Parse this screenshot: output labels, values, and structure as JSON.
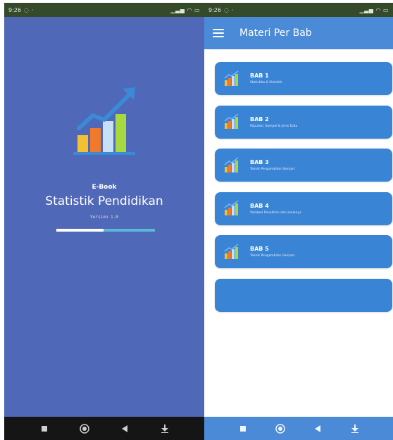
{
  "left_screen": {
    "status_bar": {
      "time": "9:26"
    },
    "splash": {
      "subtitle": "E-Book",
      "title": "Statistik Pendidikan",
      "version": "Version 1.0",
      "progress_fraction": 0.48,
      "icon": "bar-chart-growth-icon"
    },
    "nav": {
      "buttons": [
        "square-icon",
        "circle-icon",
        "back-triangle-icon",
        "download-icon"
      ]
    }
  },
  "right_screen": {
    "status_bar": {
      "time": "9:26"
    },
    "app_bar": {
      "title": "Materi Per Bab",
      "menu_icon": "hamburger-menu-icon"
    },
    "chapters": [
      {
        "title": "BAB 1",
        "description": "Statistika & Statistik"
      },
      {
        "title": "BAB 2",
        "description": "Populasi, Sampel & Jenis Data"
      },
      {
        "title": "BAB 3",
        "description": "Teknik Pengambilan Sampel"
      },
      {
        "title": "BAB 4",
        "description": "Variabel Penelitian dan skalanya"
      },
      {
        "title": "BAB 5",
        "description": "Teknik Pengambilan Sampel"
      },
      {
        "title": "",
        "description": ""
      }
    ],
    "nav": {
      "buttons": [
        "square-icon",
        "circle-icon",
        "back-triangle-icon",
        "download-icon"
      ]
    }
  },
  "colors": {
    "splash_bg": "#5068b8",
    "accent_blue": "#4a8ad6",
    "card_blue": "#3a84d6",
    "progress_track": "#5cb8d8"
  }
}
